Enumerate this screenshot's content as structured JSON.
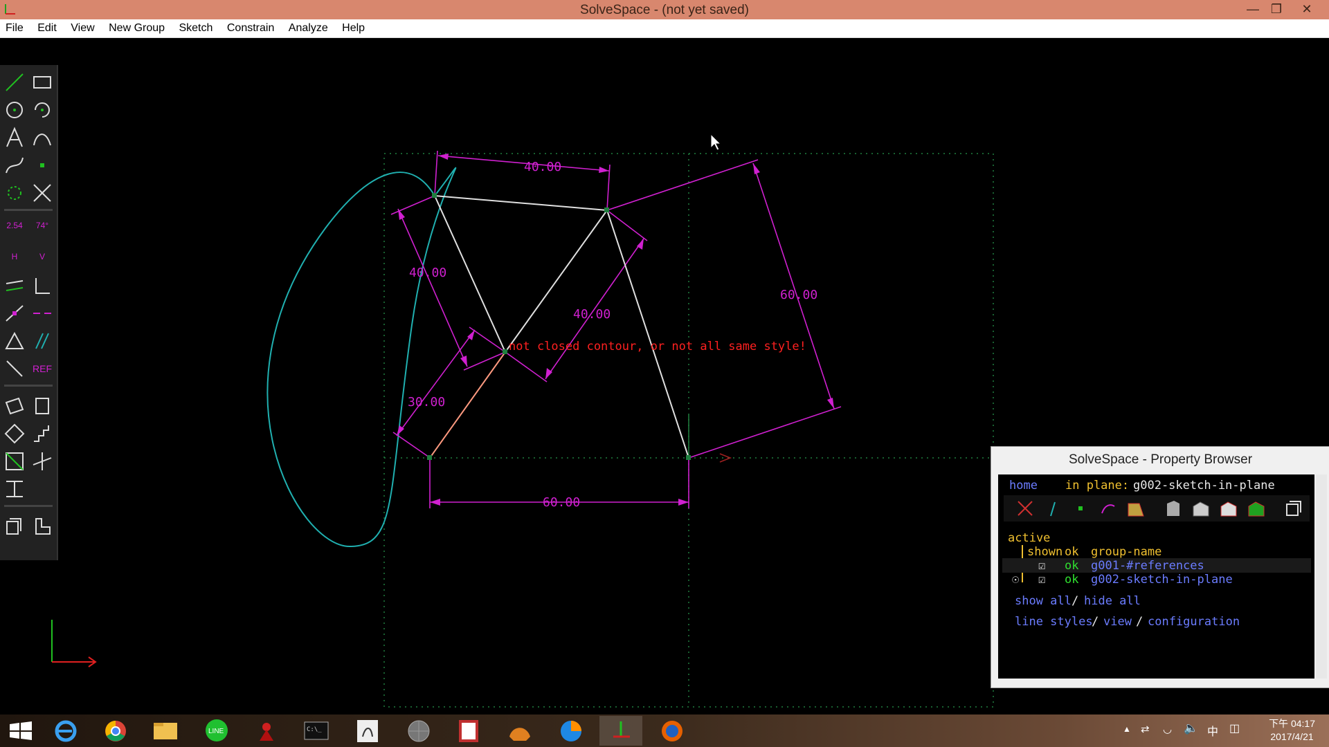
{
  "window": {
    "title": "SolveSpace - (not yet saved)"
  },
  "menu": [
    "File",
    "Edit",
    "View",
    "New Group",
    "Sketch",
    "Constrain",
    "Analyze",
    "Help"
  ],
  "toolbar": {
    "ref_label": "REF",
    "dim_label": "2.54",
    "angle_label": "74°",
    "h_label": "H",
    "v_label": "V"
  },
  "sketch": {
    "dimensions": [
      "40.00",
      "40.00",
      "40.00",
      "60.00",
      "30.00",
      "60.00"
    ],
    "error_message": "not closed contour, or not all same style!"
  },
  "property_browser": {
    "title": "SolveSpace - Property Browser",
    "home": "home",
    "in_plane_label": "in plane:",
    "in_plane_value": "g002-sketch-in-plane",
    "active_label": "active",
    "headers": {
      "shown": "shown",
      "ok": "ok",
      "name": "group-name"
    },
    "groups": [
      {
        "ok": "ok",
        "name": "g001-#references"
      },
      {
        "ok": "ok",
        "name": "g002-sketch-in-plane"
      }
    ],
    "show_all": "show all",
    "hide_all": "hide all",
    "line_styles": "line styles",
    "view": "view",
    "configuration": "configuration",
    "slash": "/"
  },
  "taskbar": {
    "time": "下午 04:17",
    "date": "2017/4/21",
    "ime": "中"
  },
  "colors": {
    "constraint": "#d020d0",
    "curve": "#20b0b0",
    "entity": "#e0e0e0",
    "error": "#ff2020",
    "workplane": "#208040"
  }
}
